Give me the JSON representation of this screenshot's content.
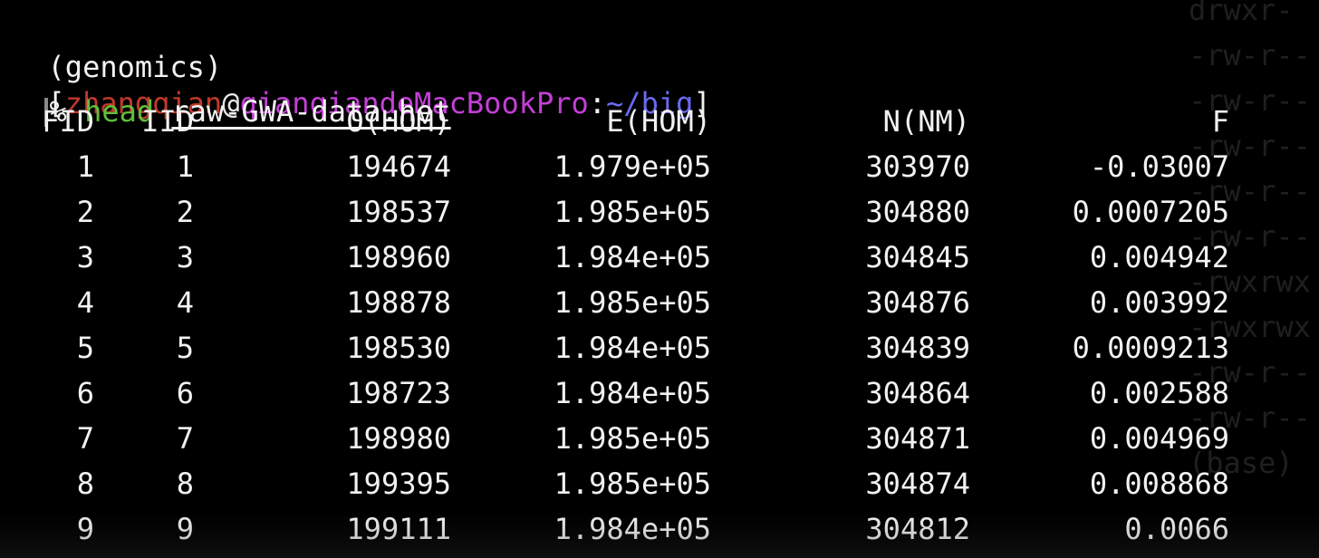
{
  "terminal": {
    "prompt": {
      "env": "(genomics)",
      "open_bracket": "[",
      "user": "zhangqian",
      "at": "@",
      "host": "qianqiandeMacBookPro",
      "colon": ":",
      "path": "~/big",
      "close_bracket": "]"
    },
    "command": {
      "prompt_symbol": "%",
      "name": "head",
      "argument": "raw-GWA-data.het"
    },
    "background_listing": [
      "drwxr-",
      "-rw-r--",
      "-rw-r--",
      "-rw-r--",
      "-rw-r--",
      "-rw-r--",
      "-rwxrwx",
      "-rwxrwx",
      "-rw-r--",
      "-rw-r--",
      "(base)"
    ],
    "table": {
      "headers": [
        "FID",
        "IID",
        "O(HOM)",
        "E(HOM)",
        "N(NM)",
        "F"
      ],
      "rows": [
        [
          "1",
          "1",
          "194674",
          "1.979e+05",
          "303970",
          "-0.03007"
        ],
        [
          "2",
          "2",
          "198537",
          "1.985e+05",
          "304880",
          "0.0007205"
        ],
        [
          "3",
          "3",
          "198960",
          "1.984e+05",
          "304845",
          "0.004942"
        ],
        [
          "4",
          "4",
          "198878",
          "1.985e+05",
          "304876",
          "0.003992"
        ],
        [
          "5",
          "5",
          "198530",
          "1.984e+05",
          "304839",
          "0.0009213"
        ],
        [
          "6",
          "6",
          "198723",
          "1.984e+05",
          "304864",
          "0.002588"
        ],
        [
          "7",
          "7",
          "198980",
          "1.985e+05",
          "304871",
          "0.004969"
        ],
        [
          "8",
          "8",
          "199395",
          "1.985e+05",
          "304874",
          "0.008868"
        ],
        [
          "9",
          "9",
          "199111",
          "1.984e+05",
          "304812",
          "0.0066"
        ]
      ]
    },
    "colors": {
      "background": "#000000",
      "text": "#f2f2f2",
      "user": "#c0392b",
      "at": "#e8e8e8",
      "host": "#c33fd6",
      "path": "#6a6af0",
      "command": "#5fbf3a"
    }
  }
}
